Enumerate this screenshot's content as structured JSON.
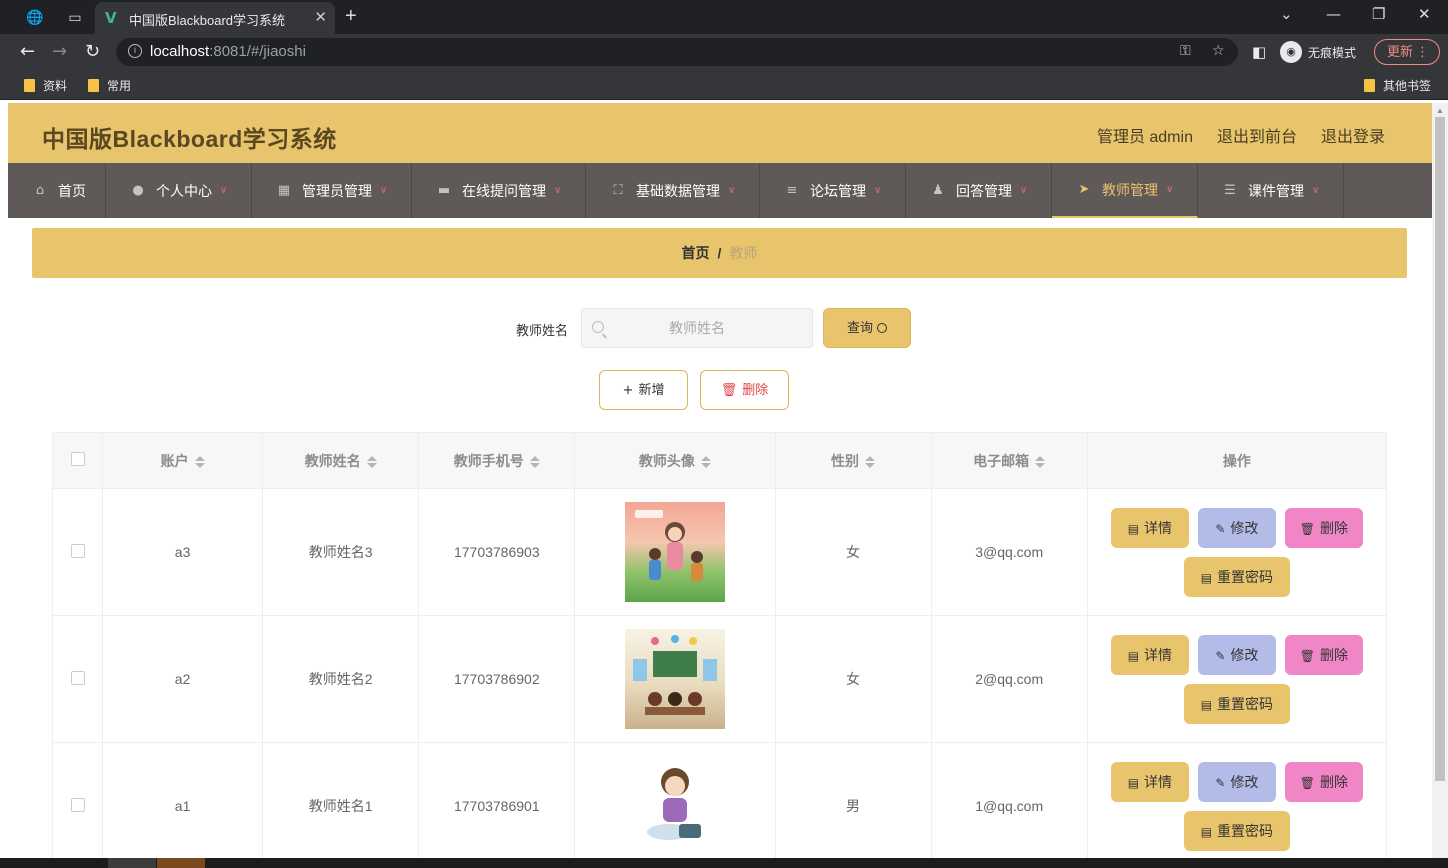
{
  "browser": {
    "tab_title": "中国版Blackboard学习系统",
    "url_host": "localhost",
    "url_rest": ":8081/#/jiaoshi",
    "incognito_label": "无痕模式",
    "update_label": "更新",
    "bookmarks": [
      {
        "label": "资料"
      },
      {
        "label": "常用"
      }
    ],
    "other_bookmarks": "其他书签"
  },
  "header": {
    "title": "中国版Blackboard学习系统",
    "user": "管理员 admin",
    "to_front": "退出到前台",
    "logout": "退出登录"
  },
  "menu": [
    {
      "label": "首页",
      "icon": "home-icon",
      "dropdown": false
    },
    {
      "label": "个人中心",
      "icon": "user-icon",
      "dropdown": true
    },
    {
      "label": "管理员管理",
      "icon": "grid-icon",
      "dropdown": true
    },
    {
      "label": "在线提问管理",
      "icon": "briefcase-icon",
      "dropdown": true
    },
    {
      "label": "基础数据管理",
      "icon": "fullscreen-icon",
      "dropdown": true
    },
    {
      "label": "论坛管理",
      "icon": "list-icon",
      "dropdown": true
    },
    {
      "label": "回答管理",
      "icon": "person-icon",
      "dropdown": true
    },
    {
      "label": "教师管理",
      "icon": "send-icon",
      "dropdown": true,
      "active": true
    },
    {
      "label": "课件管理",
      "icon": "sliders-icon",
      "dropdown": true
    }
  ],
  "breadcrumb": {
    "home": "首页",
    "separator": "/",
    "current": "教师"
  },
  "search": {
    "label": "教师姓名",
    "placeholder": "教师姓名",
    "query_label": "查询"
  },
  "actions": {
    "add_label": "新增",
    "delete_label": "删除"
  },
  "table": {
    "columns": [
      "账户",
      "教师姓名",
      "教师手机号",
      "教师头像",
      "性别",
      "电子邮箱",
      "操作"
    ],
    "rows": [
      {
        "account": "a3",
        "name": "教师姓名3",
        "phone": "17703786903",
        "gender": "女",
        "email": "3@qq.com"
      },
      {
        "account": "a2",
        "name": "教师姓名2",
        "phone": "17703786902",
        "gender": "女",
        "email": "2@qq.com"
      },
      {
        "account": "a1",
        "name": "教师姓名1",
        "phone": "17703786901",
        "gender": "男",
        "email": "1@qq.com"
      }
    ],
    "row_actions": {
      "detail": "详情",
      "edit": "修改",
      "delete": "删除",
      "reset": "重置密码"
    }
  },
  "colors": {
    "accent": "#e8c46c",
    "menu_bg": "#5f5958",
    "edit_btn": "#b3bce8",
    "delete_btn": "#f086c6",
    "danger_text": "#e14646"
  }
}
